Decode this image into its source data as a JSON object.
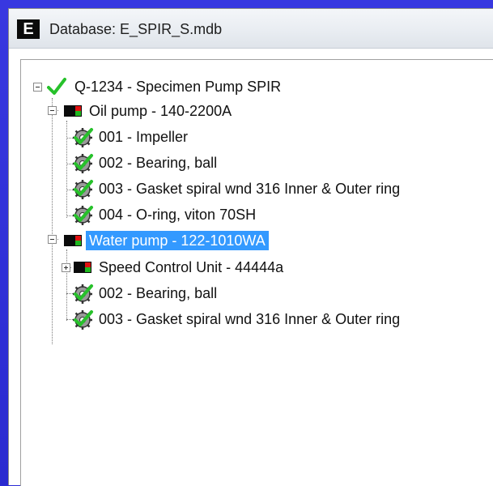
{
  "window": {
    "app_icon_letter": "E",
    "title": "Database: E_SPIR_S.mdb"
  },
  "colors": {
    "frame_blue": "#2b2bd6",
    "selection": "#3399ff",
    "check_green": "#27c12b",
    "equip_red": "#e01010",
    "equip_green": "#1fb81f"
  },
  "tree": {
    "root": {
      "label": "Q-1234 - Specimen Pump SPIR",
      "icon": "green-check-icon",
      "expanded": true
    },
    "equipment": [
      {
        "label": "Oil pump - 140-2200A",
        "icon": "equipment-status-icon",
        "expanded": true,
        "selected": false,
        "children": [
          {
            "label": "001 - Impeller",
            "icon": "spare-part-gear-check-icon"
          },
          {
            "label": "002 - Bearing, ball",
            "icon": "spare-part-gear-check-icon"
          },
          {
            "label": "003 - Gasket spiral wnd 316 Inner & Outer ring",
            "icon": "spare-part-gear-check-icon"
          },
          {
            "label": "004 - O-ring, viton 70SH",
            "icon": "spare-part-gear-check-icon"
          }
        ]
      },
      {
        "label": "Water pump - 122-1010WA",
        "icon": "equipment-status-icon",
        "expanded": true,
        "selected": true,
        "children": [
          {
            "label": "Speed Control Unit - 44444a",
            "icon": "equipment-status-icon",
            "expandable": true,
            "expanded": false
          },
          {
            "label": "002 - Bearing, ball",
            "icon": "spare-part-gear-check-icon"
          },
          {
            "label": "003 - Gasket spiral wnd 316 Inner & Outer ring",
            "icon": "spare-part-gear-check-icon"
          }
        ]
      }
    ]
  }
}
